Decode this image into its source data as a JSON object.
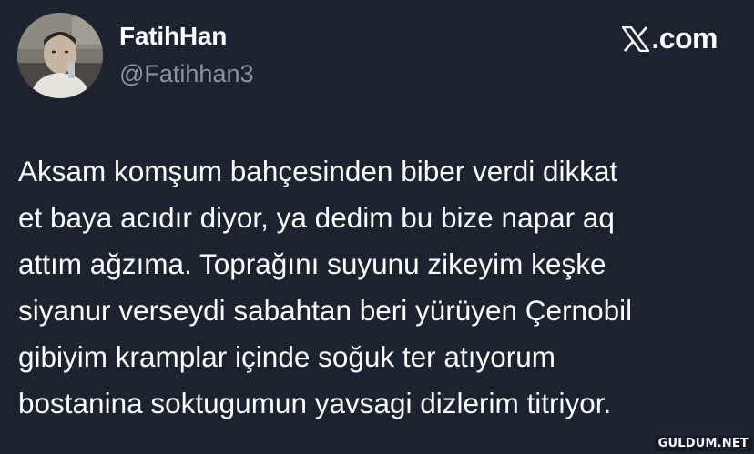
{
  "author": {
    "display_name": "FatihHan",
    "handle": "@Fatihhan3",
    "avatar_icon": "profile-photo"
  },
  "brand": {
    "logo_icon": "x-logo-icon",
    "domain_suffix": ".com"
  },
  "tweet": {
    "lines": [
      "Aksam komşum bahçesinden biber verdi dikkat",
      "et baya acıdır diyor, ya dedim bu bize napar aq",
      "attım ağzıma. Toprağını suyunu zikeyim keşke",
      "siyanur verseydi sabahtan beri yürüyen Çernobil",
      "gibiyim kramplar içinde soğuk ter atıyorum",
      "bostanina soktugumun yavsagi dizlerim titriyor."
    ]
  },
  "watermark": {
    "text": "GULDUM.NET"
  },
  "colors": {
    "background": "#1b2230",
    "text": "#ffffff",
    "handle": "#8b949f"
  }
}
